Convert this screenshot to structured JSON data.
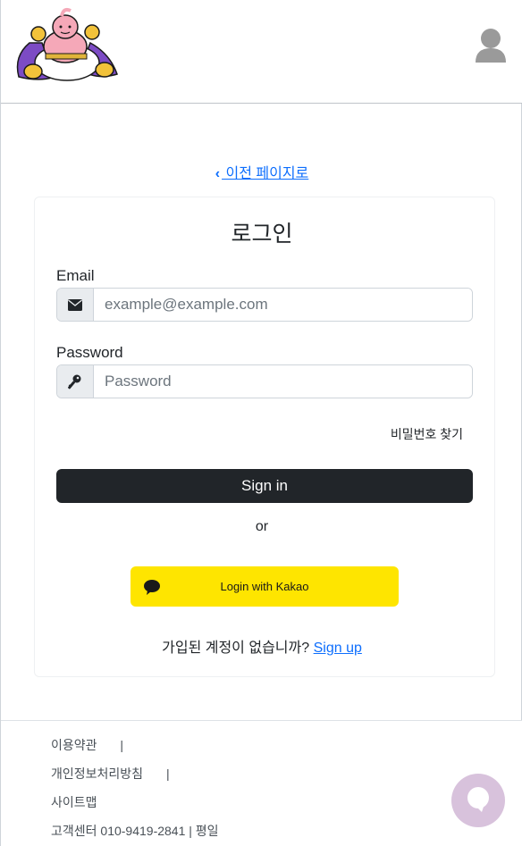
{
  "header": {
    "logo_alt": "Majin Buu character logo",
    "profile_icon": "user-icon"
  },
  "nav": {
    "back_link": "이전 페이지로"
  },
  "login": {
    "title": "로그인",
    "email_label": "Email",
    "email_placeholder": "example@example.com",
    "email_icon": "envelope-icon",
    "password_label": "Password",
    "password_placeholder": "Password",
    "password_icon": "key-icon",
    "forgot_password": "비밀번호 찾기",
    "signin_button": "Sign in",
    "or_text": "or",
    "kakao_button": "Login with Kakao",
    "kakao_icon": "speech-bubble-icon",
    "kakao_color": "#FEE500",
    "no_account_text": "가입된 계정이 없습니까?",
    "signup_link": "Sign up"
  },
  "footer": {
    "terms": "이용약관",
    "privacy": "개인정보처리방침",
    "sitemap": "사이트맵",
    "customer_center": "고객센터 010-9419-2841 | 평일",
    "separator": "|"
  },
  "chat": {
    "icon": "chat-bubble-icon"
  },
  "colors": {
    "primary_dark": "#212529",
    "link": "#0d6efd",
    "kakao_yellow": "#FEE500",
    "chat_button": "#d8c2dc"
  }
}
